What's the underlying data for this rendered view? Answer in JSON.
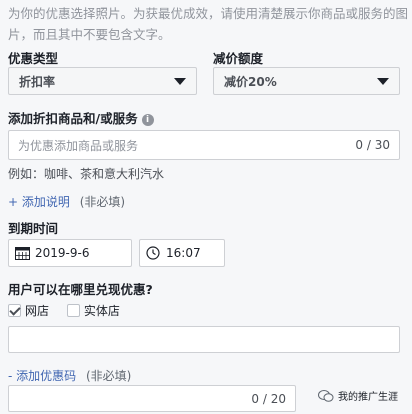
{
  "intro_text": "为你的优惠选择照片。为获最优成效，请使用清楚展示你商品或服务的图片，而且其中不要包含文字。",
  "offer_type": {
    "label": "优惠类型",
    "value": "折扣率"
  },
  "discount": {
    "label": "减价额度",
    "value": "减价20%"
  },
  "products": {
    "label": "添加折扣商品和/或服务",
    "info_icon": "i",
    "placeholder": "为优惠添加商品或服务",
    "counter": "0 / 30",
    "example": "例如：咖啡、茶和意大利汽水"
  },
  "add_description": {
    "link": "+ 添加说明",
    "optional": "(非必填)"
  },
  "expiry": {
    "label": "到期时间",
    "date": "2019-9-6",
    "time": "16:07"
  },
  "redeem": {
    "label": "用户可以在哪里兑现优惠?",
    "online": "网店",
    "in_store": "实体店"
  },
  "add_code": {
    "link": "- 添加优惠码",
    "optional": "(非必填)",
    "counter": "0 / 20"
  },
  "watermark": {
    "text": "我的推广生涯"
  },
  "colors": {
    "accent": "#4267b2",
    "border": "#ced0d4",
    "background": "#f6f7f9"
  }
}
